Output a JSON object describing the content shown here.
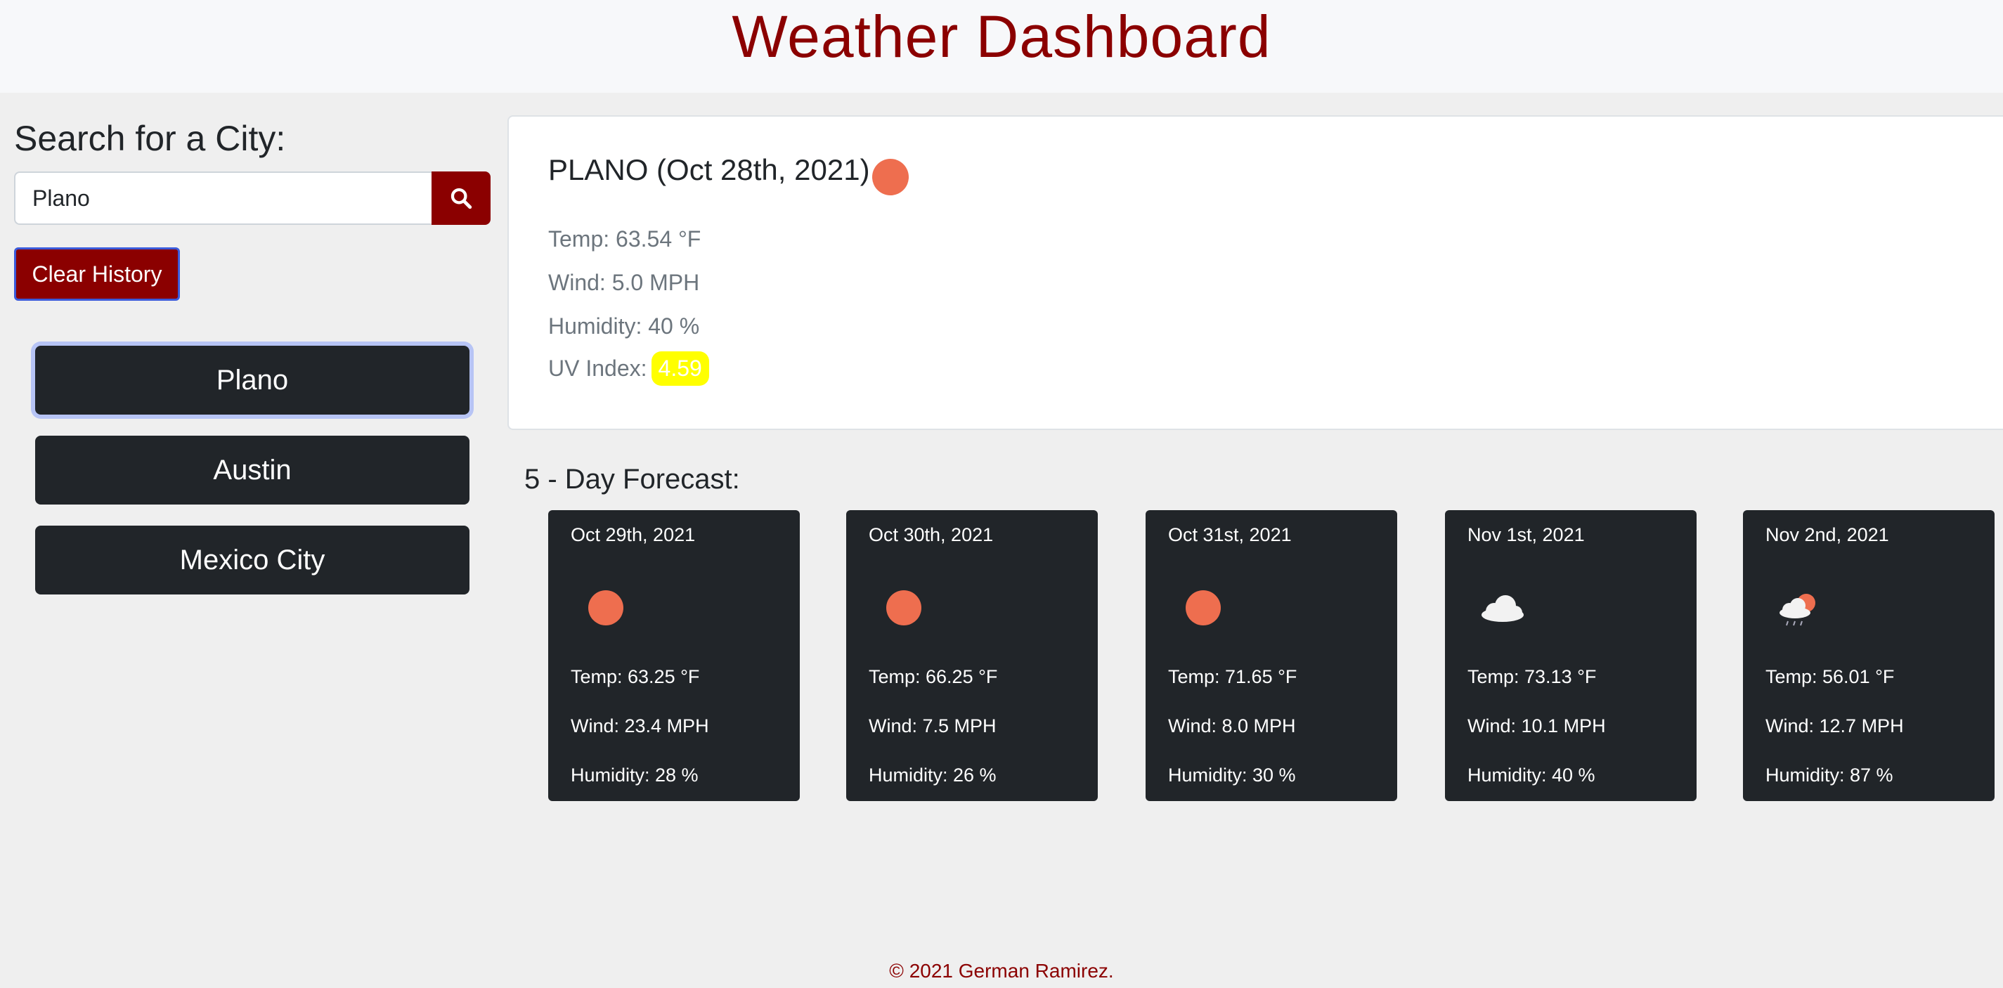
{
  "header": {
    "title": "Weather Dashboard"
  },
  "search": {
    "title": "Search for a City:",
    "value": "Plano",
    "clear_label": "Clear History"
  },
  "history": [
    {
      "label": "Plano",
      "active": true
    },
    {
      "label": "Austin",
      "active": false
    },
    {
      "label": "Mexico City",
      "active": false
    }
  ],
  "today": {
    "title": "PLANO (Oct 28th, 2021)",
    "icon": "sun-icon",
    "temp": "Temp: 63.54 °F",
    "wind": "Wind: 5.0 MPH",
    "humidity": "Humidity: 40 %",
    "uv_label": "UV Index:",
    "uv_value": "4.59"
  },
  "forecast_title": "5 - Day Forecast:",
  "forecast": [
    {
      "date": "Oct 29th, 2021",
      "icon": "sun-icon",
      "temp": "Temp: 63.25 °F",
      "wind": "Wind: 23.4 MPH",
      "humidity": "Humidity: 28 %"
    },
    {
      "date": "Oct 30th, 2021",
      "icon": "sun-icon",
      "temp": "Temp: 66.25 °F",
      "wind": "Wind: 7.5 MPH",
      "humidity": "Humidity: 26 %"
    },
    {
      "date": "Oct 31st, 2021",
      "icon": "sun-icon",
      "temp": "Temp: 71.65 °F",
      "wind": "Wind: 8.0 MPH",
      "humidity": "Humidity: 30 %"
    },
    {
      "date": "Nov 1st, 2021",
      "icon": "cloud-icon",
      "temp": "Temp: 73.13 °F",
      "wind": "Wind: 10.1 MPH",
      "humidity": "Humidity: 40 %"
    },
    {
      "date": "Nov 2nd, 2021",
      "icon": "rain-sun-icon",
      "temp": "Temp: 56.01 °F",
      "wind": "Wind: 12.7 MPH",
      "humidity": "Humidity: 87 %"
    }
  ],
  "footer": "© 2021 German Ramirez.",
  "colors": {
    "brand": "#8b0000",
    "dark": "#212529",
    "sun": "#ee6e4f",
    "uv_badge": "#ffff00"
  }
}
